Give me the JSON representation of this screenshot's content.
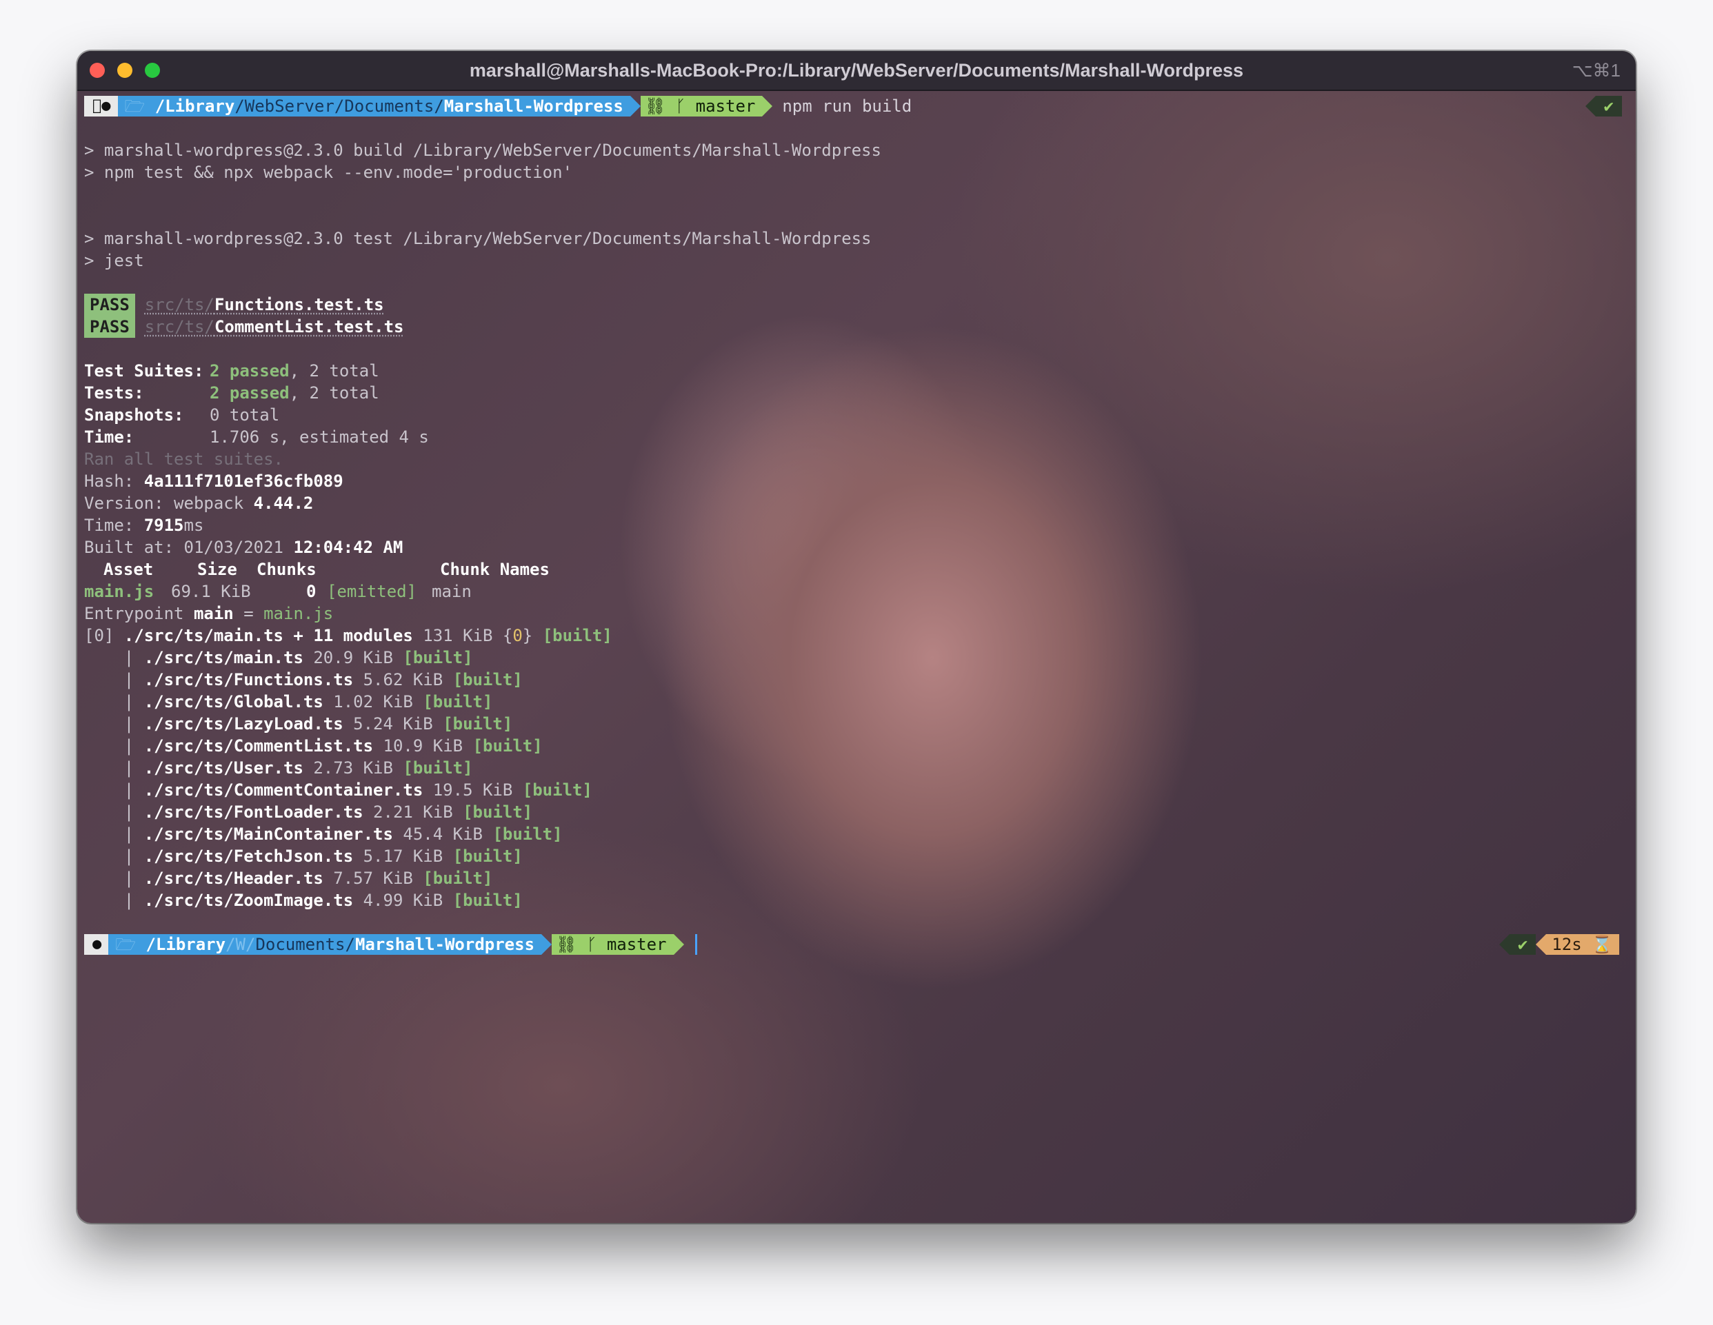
{
  "window": {
    "title": "marshall@Marshalls-MacBook-Pro:/Library/WebServer/Documents/Marshall-Wordpress",
    "shortcut": "⌥⌘1"
  },
  "prompt1": {
    "apple": "",
    "folder_icon": "🗁",
    "path_prefix": "/",
    "path_library": "Library",
    "path_mid": "/WebServer/Documents/",
    "path_repo": "Marshall-Wordpress",
    "git_icon": "⛓",
    "branch_icon": "ᚴ",
    "branch": "master",
    "command": "npm run build",
    "status": "✔"
  },
  "output": {
    "build_line1": "> marshall-wordpress@2.3.0 build /Library/WebServer/Documents/Marshall-Wordpress",
    "build_line2": "> npm test && npx webpack --env.mode='production'",
    "test_line1": "> marshall-wordpress@2.3.0 test /Library/WebServer/Documents/Marshall-Wordpress",
    "test_line2": "> jest",
    "pass_results": [
      {
        "badge": "PASS",
        "dir": "src/ts/",
        "file": "Functions.test.ts"
      },
      {
        "badge": "PASS",
        "dir": "src/ts/",
        "file": "CommentList.test.ts"
      }
    ],
    "summary": {
      "suites_label": "Test Suites:",
      "suites_passed": "2 passed",
      "suites_total": ", 2 total",
      "tests_label": "Tests:",
      "tests_passed": "2 passed",
      "tests_total": ", 2 total",
      "snapshots_label": "Snapshots:",
      "snapshots_value": "0 total",
      "time_label": "Time:",
      "time_value": "1.706 s, estimated 4 s",
      "ran_all": "Ran all test suites."
    },
    "webpack": {
      "hash_label": "Hash: ",
      "hash": "4a111f7101ef36cfb089",
      "version_label": "Version: webpack ",
      "version": "4.44.2",
      "time_label": "Time: ",
      "time_value": "7915",
      "time_unit": "ms",
      "built_label": "Built at: 01/03/2021 ",
      "built_time": "12:04:42 AM",
      "header": {
        "asset": "Asset",
        "size": "Size",
        "chunks": "Chunks",
        "chunk_names": "Chunk Names"
      },
      "asset_row": {
        "asset": "main.js",
        "size": "69.1 KiB",
        "chunks": "0",
        "emitted": "[emitted]",
        "name": "main"
      },
      "entrypoint_label": "Entrypoint ",
      "entrypoint_name": "main",
      "entrypoint_eq": " = ",
      "entrypoint_file": "main.js",
      "chunk_prefix": "[0] ",
      "chunk_module": "./src/ts/main.ts + 11 modules",
      "chunk_size": " 131 KiB {",
      "chunk_id": "0",
      "chunk_close": "} ",
      "chunk_built": "[built]",
      "modules": [
        {
          "path": "./src/ts/main.ts",
          "size": " 20.9 KiB ",
          "status": "[built]"
        },
        {
          "path": "./src/ts/Functions.ts",
          "size": " 5.62 KiB ",
          "status": "[built]"
        },
        {
          "path": "./src/ts/Global.ts",
          "size": " 1.02 KiB ",
          "status": "[built]"
        },
        {
          "path": "./src/ts/LazyLoad.ts",
          "size": " 5.24 KiB ",
          "status": "[built]"
        },
        {
          "path": "./src/ts/CommentList.ts",
          "size": " 10.9 KiB ",
          "status": "[built]"
        },
        {
          "path": "./src/ts/User.ts",
          "size": " 2.73 KiB ",
          "status": "[built]"
        },
        {
          "path": "./src/ts/CommentContainer.ts",
          "size": " 19.5 KiB ",
          "status": "[built]"
        },
        {
          "path": "./src/ts/FontLoader.ts",
          "size": " 2.21 KiB ",
          "status": "[built]"
        },
        {
          "path": "./src/ts/MainContainer.ts",
          "size": " 45.4 KiB ",
          "status": "[built]"
        },
        {
          "path": "./src/ts/FetchJson.ts",
          "size": " 5.17 KiB ",
          "status": "[built]"
        },
        {
          "path": "./src/ts/Header.ts",
          "size": " 7.57 KiB ",
          "status": "[built]"
        },
        {
          "path": "./src/ts/ZoomImage.ts",
          "size": " 4.99 KiB ",
          "status": "[built]"
        }
      ]
    }
  },
  "prompt2": {
    "path_prefix": "/",
    "path_library": "Library",
    "path_w": "/W/",
    "path_mid": "Documents/",
    "path_repo": "Marshall-Wordpress",
    "branch": "master",
    "status": "✔",
    "duration": "12s",
    "hourglass": "⌛"
  }
}
